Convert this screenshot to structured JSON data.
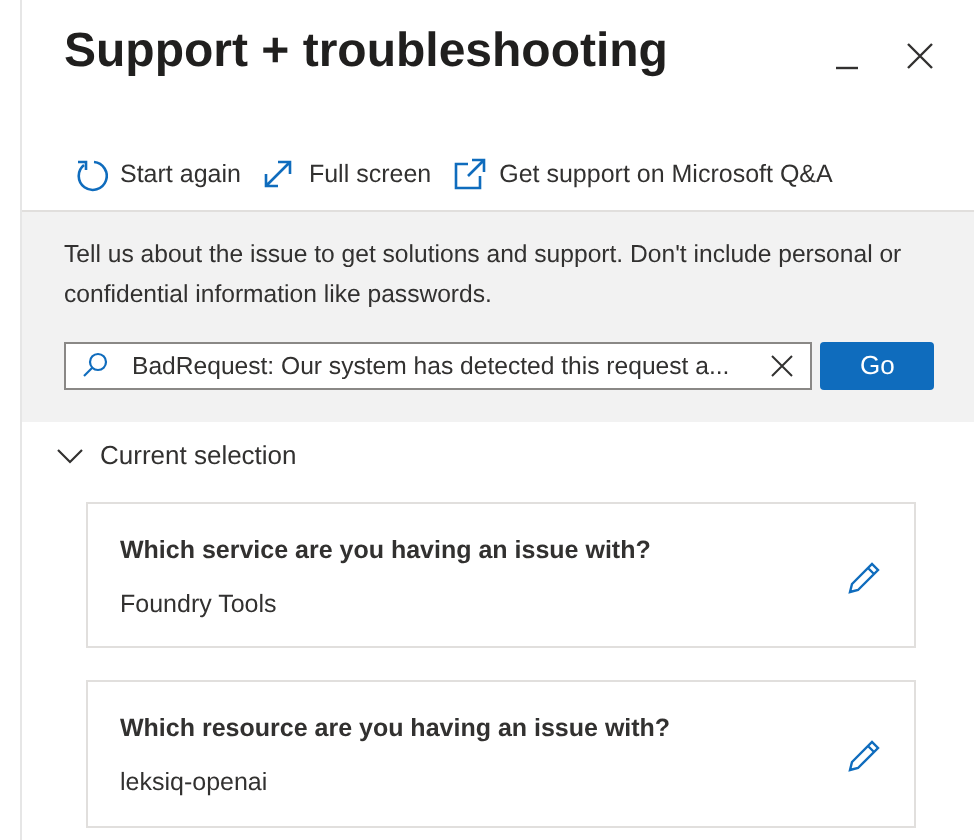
{
  "panel": {
    "title": "Support + troubleshooting"
  },
  "toolbar": [
    {
      "kind": "refresh",
      "label": "Start again"
    },
    {
      "kind": "expand",
      "label": "Full screen"
    },
    {
      "kind": "external",
      "label": "Get support on Microsoft Q&A"
    }
  ],
  "intro": {
    "text": "Tell us about the issue to get solutions and support. Don't include personal or confidential information like passwords.",
    "search_value": "BadRequest: Our system has detected this request a...",
    "button": "Go"
  },
  "section": {
    "title": "Current selection",
    "expanded": true,
    "cards": [
      {
        "question": "Which service are you having an issue with?",
        "answer": "Foundry Tools"
      },
      {
        "question": "Which resource are you having an issue with?",
        "answer": "leksiq-openai"
      }
    ]
  }
}
